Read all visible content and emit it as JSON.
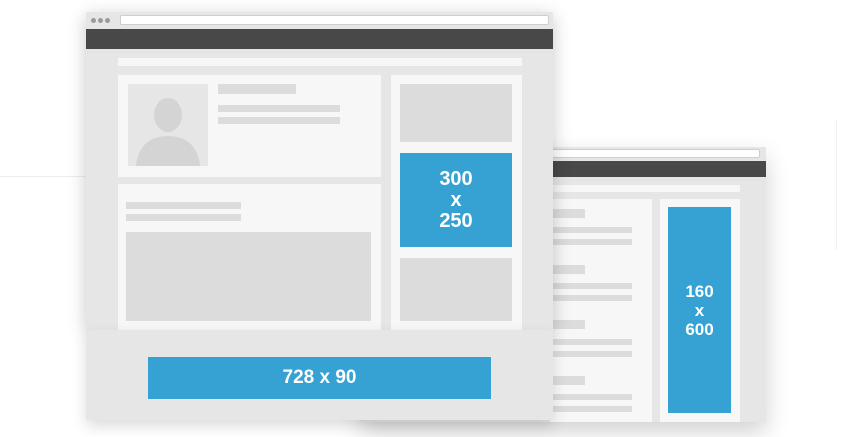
{
  "colors": {
    "ad_blue": "#35a2d3",
    "chrome_dark": "#484848",
    "page_gray": "#e6e6e6",
    "card": "#f7f7f7",
    "placeholder": "#dcdcdc"
  },
  "ads": {
    "medium_rectangle": {
      "line1": "300",
      "line2": "x",
      "line3": "250"
    },
    "leaderboard": {
      "label": "728 x 90"
    },
    "skyscraper": {
      "line1": "160",
      "line2": "x",
      "line3": "600"
    }
  }
}
